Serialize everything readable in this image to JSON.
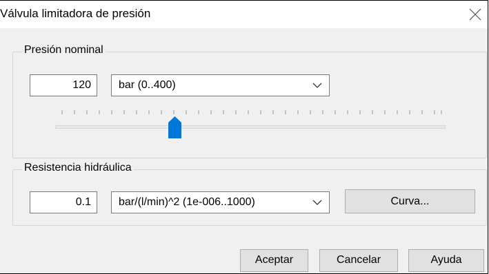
{
  "dialog": {
    "title": "Válvula limitadora de presión"
  },
  "nominal_pressure": {
    "group_label": "Presión nominal",
    "value": "120",
    "unit": "bar  (0..400)",
    "slider_fraction": 0.3
  },
  "hydraulic_resistance": {
    "group_label": "Resistencia hidráulica",
    "value": "0.1",
    "unit": "bar/(l/min)^2  (1e-006..1000)",
    "curve_button": "Curva..."
  },
  "footer": {
    "accept": "Aceptar",
    "cancel": "Cancelar",
    "help": "Ayuda"
  },
  "colors": {
    "slider_thumb": "#0078d7",
    "dialog_bg": "#f0f0f0"
  },
  "icons": {
    "close": "close-icon",
    "dropdown": "chevron-down-icon",
    "slider": "slider-thumb"
  }
}
